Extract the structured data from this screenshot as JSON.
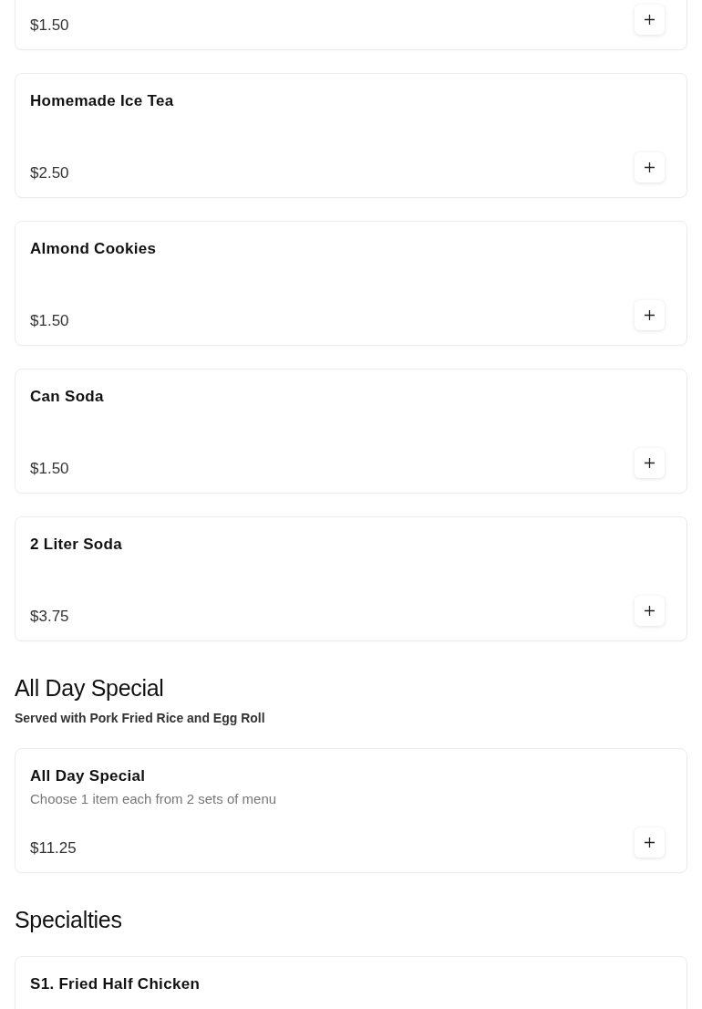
{
  "sections": [
    {
      "items": [
        {
          "price": "$1.50"
        }
      ]
    },
    {
      "items": [
        {
          "name": "Homemade Ice Tea",
          "price": "$2.50"
        },
        {
          "name": "Almond Cookies",
          "price": "$1.50"
        },
        {
          "name": "Can Soda",
          "price": "$1.50"
        },
        {
          "name": "2 Liter Soda",
          "price": "$3.75"
        }
      ]
    },
    {
      "title": "All Day Special",
      "subtitle": "Served with Pork Fried Rice and Egg Roll",
      "items": [
        {
          "name": "All Day Special",
          "description": "Choose 1 item each from 2 sets of menu",
          "price": "$11.25"
        }
      ]
    },
    {
      "title": "Specialties",
      "items": [
        {
          "name": "S1. Fried Half Chicken"
        }
      ]
    }
  ]
}
